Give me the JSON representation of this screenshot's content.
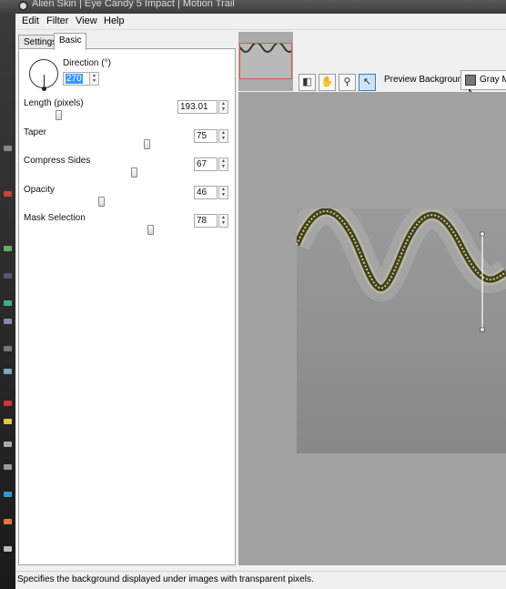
{
  "window": {
    "title": "Alien Skin | Eye Candy 5 Impact | Motion Trail"
  },
  "menu": {
    "items": [
      "Edit",
      "Filter",
      "View",
      "Help"
    ]
  },
  "tabs": [
    {
      "label": "Settings"
    },
    {
      "label": "Basic",
      "active": true
    }
  ],
  "direction": {
    "label": "Direction (°)",
    "value": "270"
  },
  "params": [
    {
      "label": "Length (pixels)",
      "value": "193.01",
      "slider": 0.22
    },
    {
      "label": "Taper",
      "value": "75",
      "slider": 0.75
    },
    {
      "label": "Compress Sides",
      "value": "67",
      "slider": 0.67
    },
    {
      "label": "Opacity",
      "value": "46",
      "slider": 0.46
    },
    {
      "label": "Mask Selection",
      "value": "78",
      "slider": 0.78
    }
  ],
  "preview": {
    "tools": [
      "preview-compare-icon",
      "hand-pan-icon",
      "zoom-magnifier-icon",
      "arrow-select-icon"
    ],
    "background_label": "Preview Background:",
    "background_value": "Gray Ma",
    "background_color": "#777777"
  },
  "status": {
    "text": "Specifies the background displayed under images with transparent pixels."
  }
}
